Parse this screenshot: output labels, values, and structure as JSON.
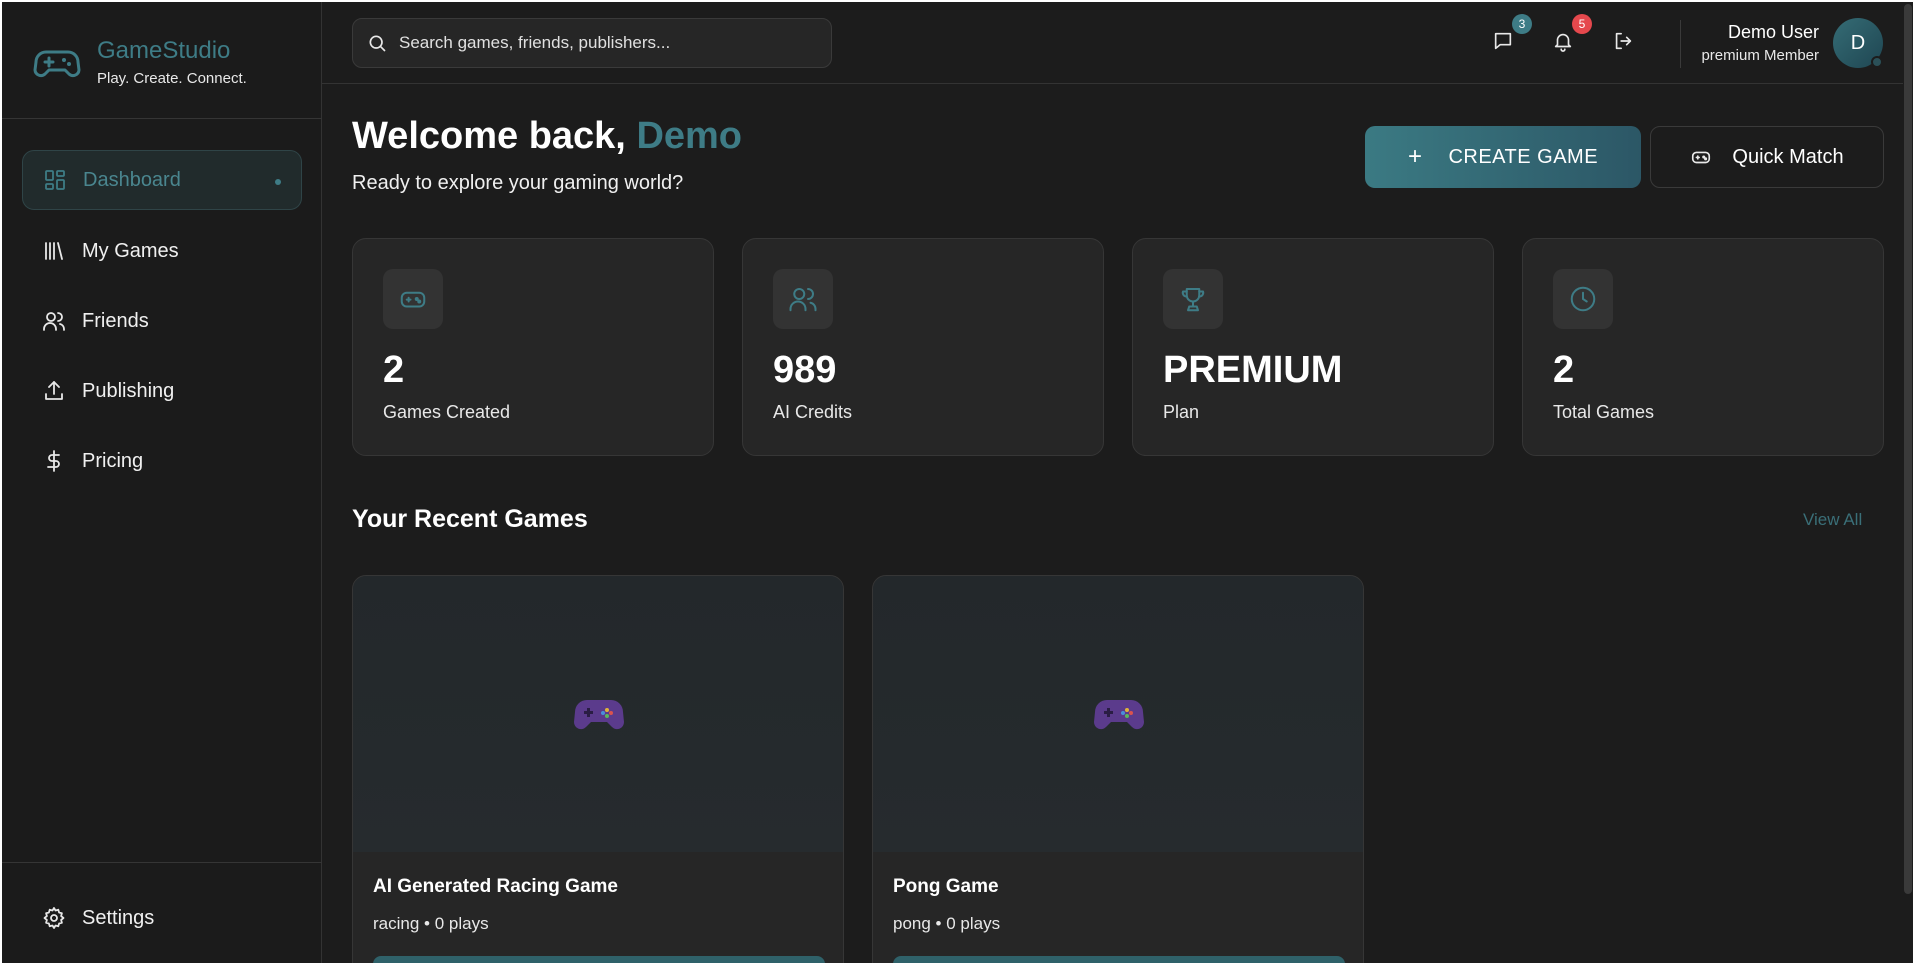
{
  "brand": {
    "name": "GameStudio",
    "tagline": "Play. Create. Connect."
  },
  "sidebar": {
    "items": [
      {
        "label": "Dashboard",
        "icon": "dashboard-icon",
        "active": true
      },
      {
        "label": "My Games",
        "icon": "library-icon"
      },
      {
        "label": "Friends",
        "icon": "users-icon"
      },
      {
        "label": "Publishing",
        "icon": "upload-icon"
      },
      {
        "label": "Pricing",
        "icon": "dollar-icon"
      }
    ],
    "settings_label": "Settings"
  },
  "header": {
    "search_placeholder": "Search games, friends, publishers...",
    "messages_count": "3",
    "notifications_count": "5",
    "user_name": "Demo User",
    "user_role": "premium Member",
    "avatar_initial": "D"
  },
  "main": {
    "welcome_prefix": "Welcome back, ",
    "welcome_name": "Demo",
    "subtitle": "Ready to explore your gaming world?",
    "create_label": "CREATE GAME",
    "quick_label": "Quick Match",
    "stats": [
      {
        "value": "2",
        "label": "Games Created",
        "icon": "gamepad-icon"
      },
      {
        "value": "989",
        "label": "AI Credits",
        "icon": "users-icon"
      },
      {
        "value": "PREMIUM",
        "label": "Plan",
        "icon": "trophy-icon"
      },
      {
        "value": "2",
        "label": "Total Games",
        "icon": "clock-icon"
      }
    ],
    "recent_title": "Your Recent Games",
    "view_all": "View All",
    "games": [
      {
        "title": "AI Generated Racing Game",
        "meta": "racing • 0 plays"
      },
      {
        "title": "Pong Game",
        "meta": "pong • 0 plays"
      }
    ]
  },
  "colors": {
    "accent": "#3e7c86",
    "background": "#1c1c1c",
    "card": "#262626",
    "badge_messages": "#3e7c86",
    "badge_notifications": "#e5484d"
  }
}
